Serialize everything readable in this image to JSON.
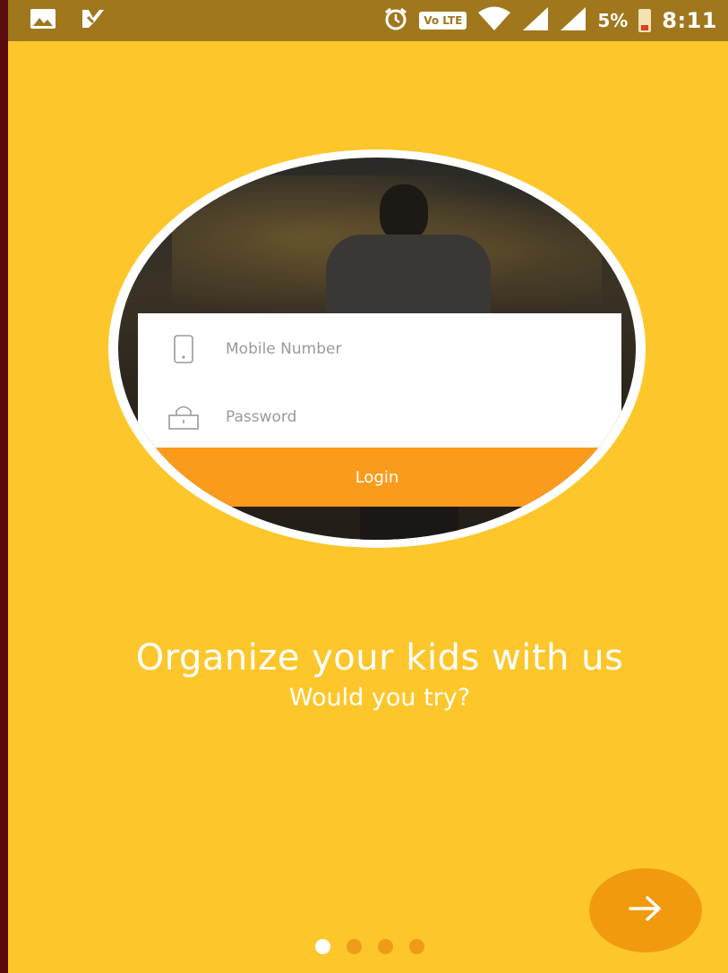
{
  "status_bar": {
    "left_icons": [
      "gallery-icon",
      "notification-icon"
    ],
    "right_icons": [
      "alarm-icon",
      "volte-badge",
      "wifi-icon",
      "signal-icon",
      "signal-icon",
      "battery-low-icon"
    ],
    "volte_label": "Vo LTE",
    "battery_percent": "5%",
    "time": "8:11"
  },
  "illustration": {
    "mobile_placeholder": "Mobile Number",
    "password_placeholder": "Password",
    "login_label": "Login",
    "icons": [
      "phone-icon",
      "lock-icon"
    ]
  },
  "onboarding": {
    "title": "Organize your kids with us",
    "subtitle": "Would you try?",
    "page_count": 4,
    "active_page": 1,
    "next_icon": "arrow-right-icon"
  },
  "colors": {
    "background": "#fdc62a",
    "status_bar": "#a0771d",
    "accent": "#f29a0e",
    "button": "#fb9b1c"
  }
}
